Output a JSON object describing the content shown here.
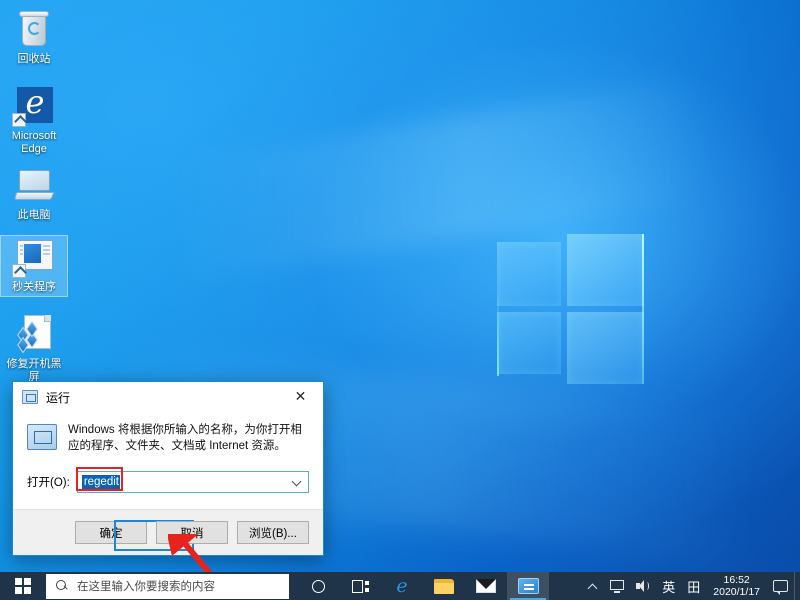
{
  "desktop": {
    "icons": [
      {
        "label": "回收站",
        "icon": "recycle-bin-icon",
        "selected": false
      },
      {
        "label": "Microsoft Edge",
        "icon": "microsoft-edge-icon",
        "selected": false
      },
      {
        "label": "此电脑",
        "icon": "this-pc-icon",
        "selected": false
      },
      {
        "label": "秒关程序",
        "icon": "program-shortcut-icon",
        "selected": true
      },
      {
        "label": "修复开机黑屏",
        "icon": "repair-boot-icon",
        "selected": false
      }
    ]
  },
  "run_dialog": {
    "title": "运行",
    "title_icon": "run-window-icon",
    "close_label": "✕",
    "message": "Windows 将根据你所输入的名称，为你打开相应的程序、文件夹、文档或 Internet 资源。",
    "message_icon": "run-info-icon",
    "open_label": "打开(O):",
    "open_value": "regedit",
    "combo_arrow_icon": "chevron-down-icon",
    "buttons": {
      "ok": "确定",
      "cancel": "取消",
      "browse": "浏览(B)..."
    },
    "annotations": {
      "value_box_color": "#e8231c",
      "ok_box_color": "#1c86d8",
      "arrow_color": "#e8231c"
    }
  },
  "taskbar": {
    "start_icon": "windows-start-icon",
    "search": {
      "icon": "search-icon",
      "placeholder": "在这里输入你要搜索的内容",
      "value": ""
    },
    "buttons": [
      {
        "name": "cortana-button",
        "icon": "cortana-circle-icon",
        "active": false
      },
      {
        "name": "task-view-button",
        "icon": "task-view-icon",
        "active": false
      },
      {
        "name": "edge-button",
        "icon": "microsoft-edge-icon",
        "active": false
      },
      {
        "name": "file-explorer-button",
        "icon": "folder-icon",
        "active": false
      },
      {
        "name": "mail-button",
        "icon": "mail-envelope-icon",
        "active": false
      },
      {
        "name": "active-app-button",
        "icon": "app-window-icon",
        "active": true
      }
    ],
    "tray": {
      "chevron_icon": "chevron-up-icon",
      "network_icon": "network-monitor-icon",
      "volume_icon": "speaker-icon",
      "ime_label": "英",
      "ime_mode_label": "田",
      "time": "16:52",
      "date": "2020/1/17",
      "notification_icon": "action-center-icon"
    }
  },
  "theme": {
    "taskbar_bg": "#1f3349",
    "accent": "#0a64b4",
    "dialog_border": "#1c86d8",
    "desktop_blue": "#0a7fd4"
  }
}
